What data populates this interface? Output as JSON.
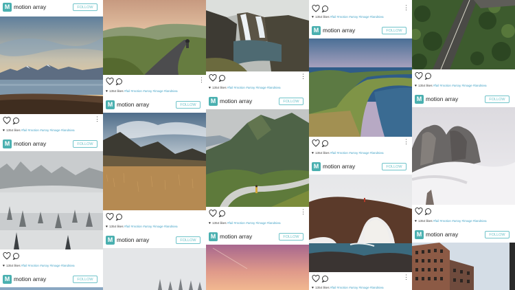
{
  "brand": "motion array",
  "follow_label": "FOLLOW",
  "avatar_letter": "M",
  "likes_text": "1354 likes",
  "tags_text": "#fail #motion #array #image #landsiea",
  "accent": "#4ab0b0",
  "follow_color": "#6fc3c9",
  "tag_color": "#4aa6c8",
  "icons": [
    "heart-icon",
    "comment-icon",
    "more-options-icon",
    "avatar-icon"
  ],
  "posts": [
    {
      "id": "c1a",
      "scene": "lake-mountains-sunset"
    },
    {
      "id": "c1b",
      "scene": "foggy-forest"
    },
    {
      "id": "c2a",
      "scene": "cyclist-road-hills"
    },
    {
      "id": "c2b",
      "scene": "golden-grass-mountain"
    },
    {
      "id": "c2c",
      "scene": "snowy-trees"
    },
    {
      "id": "c3a",
      "scene": "waterfall-cliffs"
    },
    {
      "id": "c3b",
      "scene": "green-mountain-road"
    },
    {
      "id": "c3c",
      "scene": "pink-sky"
    },
    {
      "id": "c4a",
      "scene": "coastal-peninsula"
    },
    {
      "id": "c4b",
      "scene": "rock-arch-sea"
    },
    {
      "id": "c5a",
      "scene": "aerial-forest-road"
    },
    {
      "id": "c5b",
      "scene": "misty-rock-peaks"
    },
    {
      "id": "c5c",
      "scene": "city-buildings"
    }
  ]
}
